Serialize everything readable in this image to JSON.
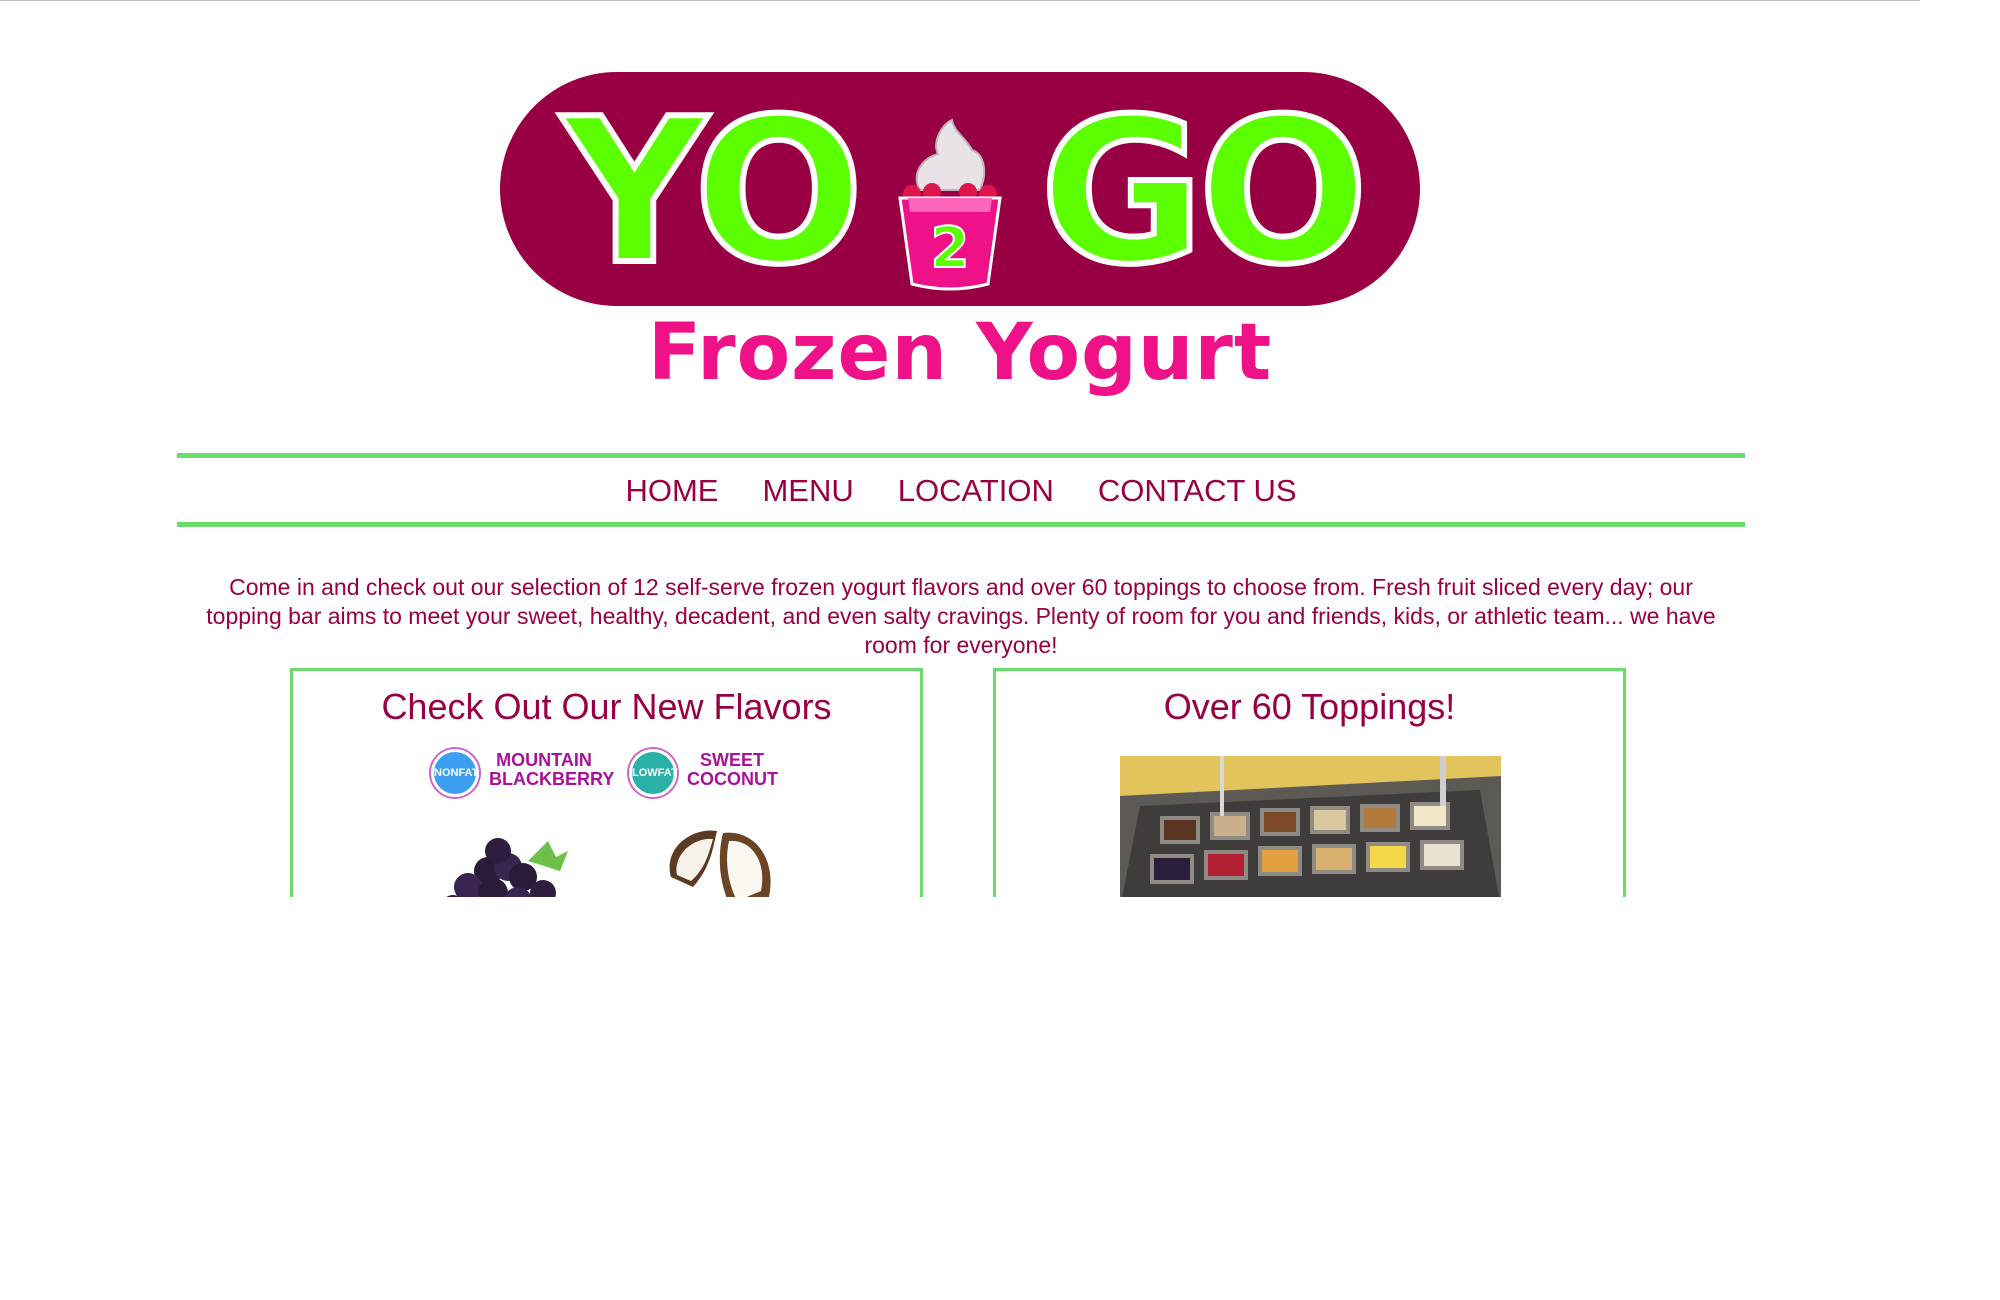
{
  "logo": {
    "word_left": "YO",
    "number": "2",
    "word_right": "GO",
    "tagline": "Frozen Yogurt"
  },
  "nav": {
    "items": [
      "HOME",
      "MENU",
      "LOCATION",
      "CONTACT US"
    ]
  },
  "intro": "Come in and check out our selection of 12 self-serve frozen yogurt flavors and over 60 toppings to choose from. Fresh fruit sliced every day; our topping bar aims to meet your sweet, healthy, decadent, and even salty cravings. Plenty of room for you and friends, kids, or athletic team... we have room for everyone!",
  "panels": {
    "flavors": {
      "title": "Check Out Our New Flavors",
      "flavor1": {
        "badge": "NONFAT",
        "name_line1": "MOUNTAIN",
        "name_line2": "BLACKBERRY"
      },
      "flavor2": {
        "badge": "LOWFAT",
        "name_line1": "SWEET",
        "name_line2": "COCONUT"
      }
    },
    "toppings": {
      "title": "Over 60 Toppings!"
    }
  },
  "colors": {
    "brand": "#990044",
    "accent_green": "#6bdc6b",
    "logo_green": "#5cff00",
    "pink": "#ee1188"
  }
}
